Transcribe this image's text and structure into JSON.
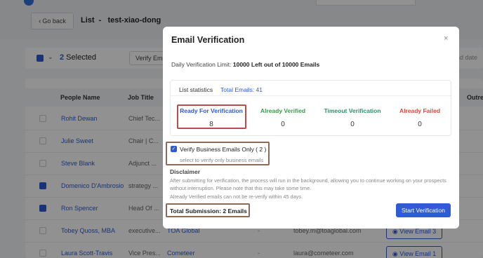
{
  "header": {
    "back_label": "Go back",
    "list_title": "List  -   test-xiao-dong"
  },
  "toolbar": {
    "selected_count": "2",
    "selected_label": " Selected",
    "verify_button": "Verify Ema",
    "date_filter": "ad date"
  },
  "table": {
    "columns": [
      "People Name",
      "Job Title",
      "Outrea"
    ],
    "rows": [
      {
        "name": "Rohit Dewan",
        "job": "Chief Tec...",
        "checked": false
      },
      {
        "name": "Julie Sweet",
        "job": "Chair | C...",
        "checked": false
      },
      {
        "name": "Steve Blank",
        "job": "Adjunct ...",
        "checked": false
      },
      {
        "name": "Domenico D'Ambrosio",
        "job": "strategy ...",
        "checked": true
      },
      {
        "name": "Ron Spencer",
        "job": "Head Of ...",
        "checked": true
      },
      {
        "name": "Tobey Quoss, MBA",
        "job": "executive...",
        "company": "TOA Global",
        "dash": "-",
        "email": "tobey.m@toaglobal.com",
        "view": "View Email 3",
        "checked": false
      },
      {
        "name": "Laura Scott-Travis",
        "job": "Vice Pres...",
        "company": "Cometeer",
        "dash": "-",
        "email": "laura@cometeer.com",
        "view": "View Email 1",
        "checked": false
      }
    ]
  },
  "modal": {
    "title": "Email Verification",
    "close_icon": "×",
    "limit_prefix": "Daily Verification Limit: ",
    "limit_value": "10000 Left out of 10000 Emails",
    "stats_label": "List statistics",
    "total_emails": "Total Emails: 41",
    "stats": [
      {
        "label": "Ready For Verification",
        "value": "8",
        "color": "#2f5bd4"
      },
      {
        "label": "Already Verified",
        "value": "0",
        "color": "#3a9a4a"
      },
      {
        "label": "Timeout Verification",
        "value": "0",
        "color": "#2e8f6a"
      },
      {
        "label": "Already Failed",
        "value": "0",
        "color": "#d9483b"
      }
    ],
    "verify_business_label": "Verify Business Emails Only ( 2 )",
    "verify_business_hint": "select to verify only business emails",
    "disclaimer_title": "Disclaimer",
    "disclaimer_text": "After submitting for verification, the process will run in the background, allowing you to continue working on your prospects without interruption. Please note that this may take some time.",
    "disclaimer_note": "Already Verified emails can not be re-verify within 45 days.",
    "submission": "Total Submission: 2 Emails",
    "start_button": "Start Verification"
  }
}
